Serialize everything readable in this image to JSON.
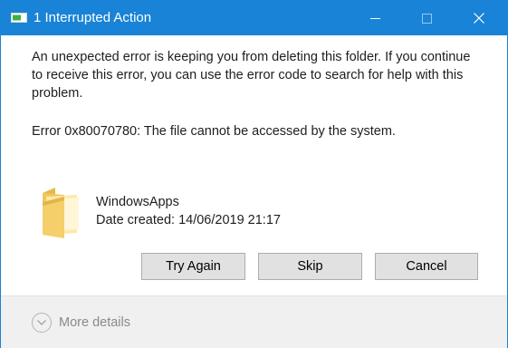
{
  "window": {
    "title": "1 Interrupted Action",
    "controls": [
      "minimize-icon",
      "maximize-icon",
      "close-icon"
    ]
  },
  "message": {
    "body": "An unexpected error is keeping you from deleting this folder. If you continue to receive this error, you can use the error code to search for help with this problem.",
    "error": "Error 0x80070780: The file cannot be accessed by the system."
  },
  "item": {
    "icon": "folder-icon",
    "name": "WindowsApps",
    "date_created": "Date created: 14/06/2019 21:17"
  },
  "buttons": {
    "try_again": "Try Again",
    "skip": "Skip",
    "cancel": "Cancel"
  },
  "footer": {
    "details_icon": "chevron-down-icon",
    "more_details": "More details"
  },
  "colors": {
    "titlebar": "#1883d7",
    "footer_bg": "#f0f0f0",
    "button_bg": "#e1e1e1"
  }
}
